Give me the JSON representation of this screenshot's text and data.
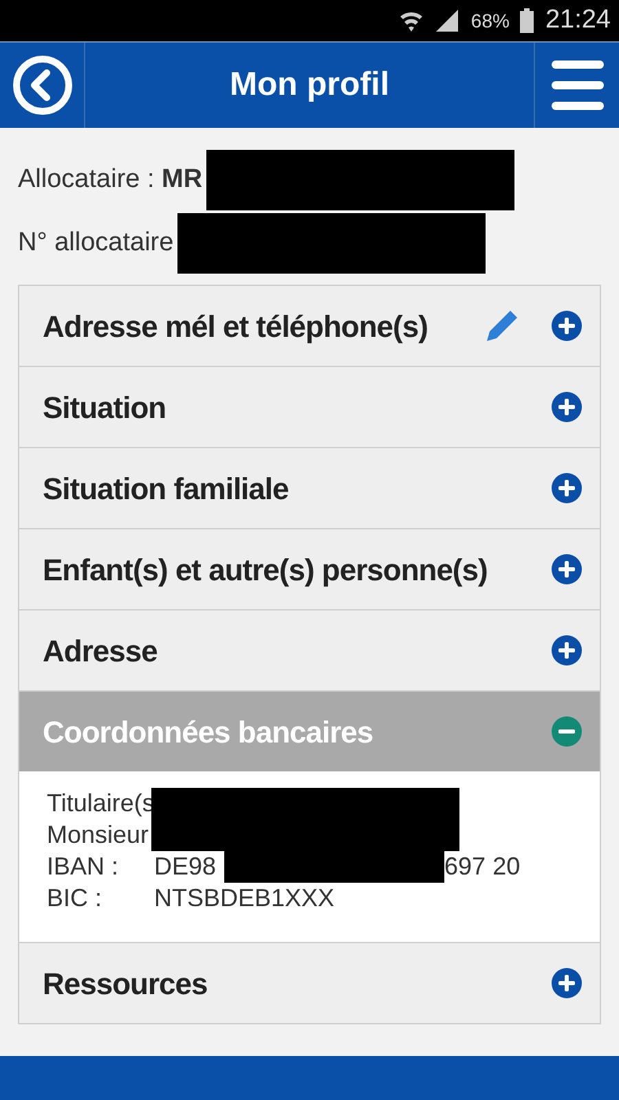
{
  "status_bar": {
    "battery": "68%",
    "time": "21:24"
  },
  "header": {
    "title": "Mon profil"
  },
  "info": [
    {
      "label": "Allocataire : ",
      "value": "MR",
      "redacted": true
    },
    {
      "label": "N° allocataire",
      "redacted": true
    }
  ],
  "sections": [
    {
      "title": "Adresse mél et téléphone(s)",
      "expanded": false,
      "editable": true
    },
    {
      "title": "Situation",
      "expanded": false,
      "editable": false
    },
    {
      "title": "Situation familiale",
      "expanded": false,
      "editable": false
    },
    {
      "title": "Enfant(s) et autre(s) personne(s)",
      "expanded": false,
      "editable": false
    },
    {
      "title": "Adresse",
      "expanded": false,
      "editable": false
    },
    {
      "title": "Coordonnées bancaires",
      "expanded": true,
      "editable": false,
      "details": [
        {
          "label": "Titulaire(s",
          "redacted": true
        },
        {
          "label": "Monsieur",
          "redacted": true
        },
        {
          "label": "IBAN :",
          "value": "DE98",
          "tail": "697 20",
          "redacted": true
        },
        {
          "label": "BIC :",
          "value": "NTSBDEB1XXX",
          "redacted": false
        }
      ]
    },
    {
      "title": "Ressources",
      "expanded": false,
      "editable": false
    }
  ]
}
